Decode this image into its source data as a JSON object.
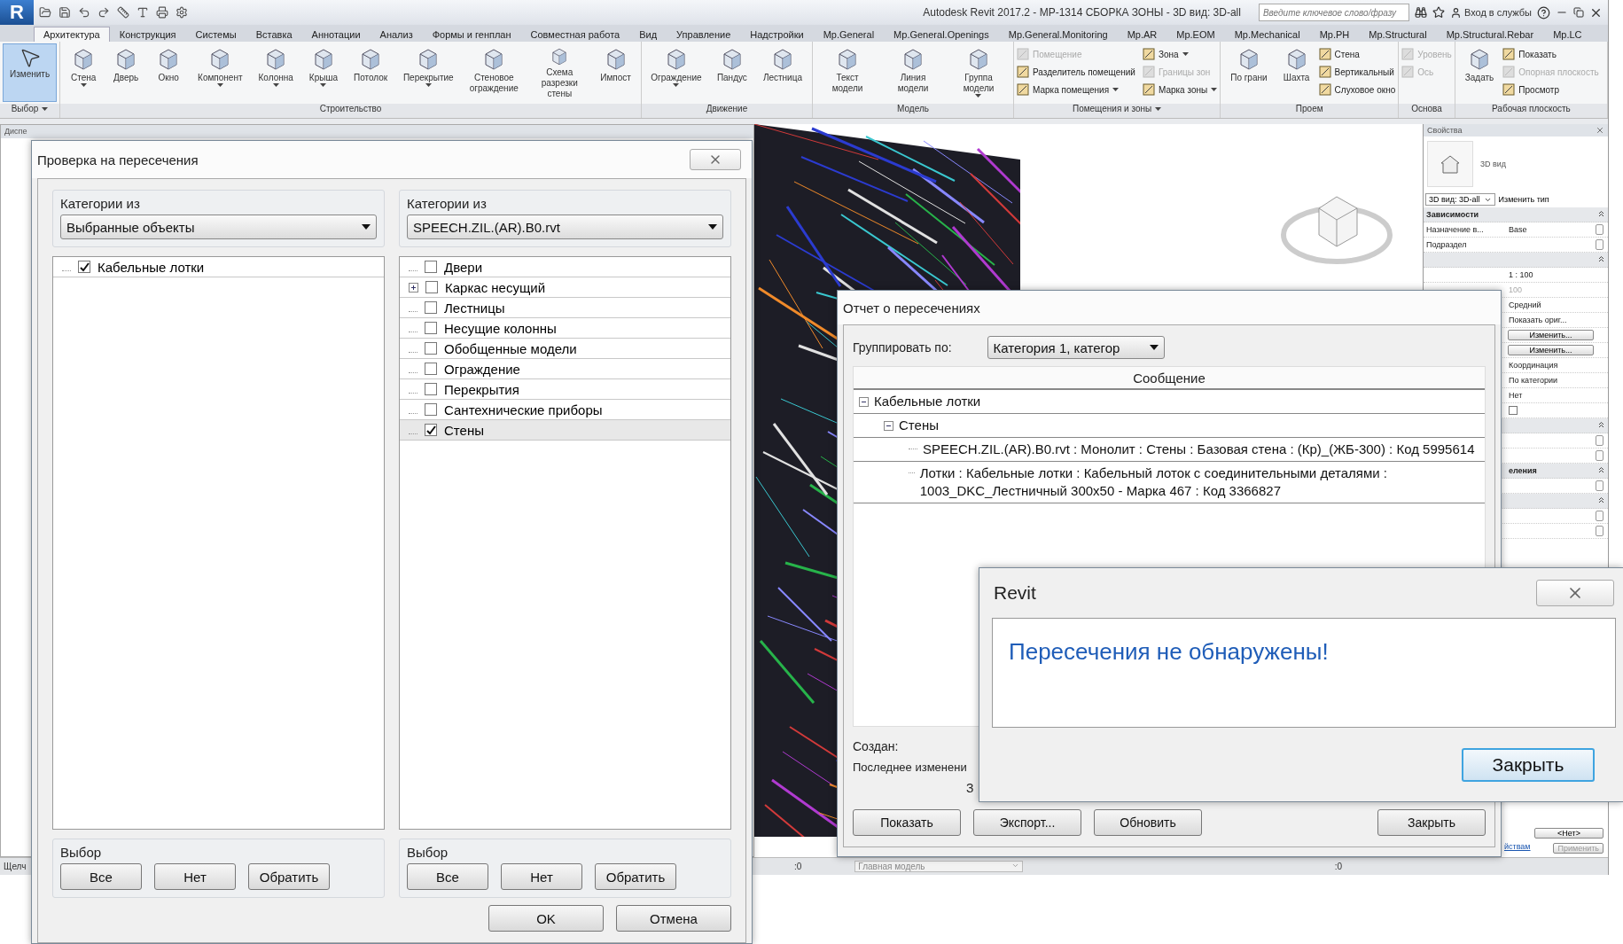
{
  "app": {
    "logo": "R",
    "title": "Autodesk Revit 2017.2 -   MP-1314 СБОРКА ЗОНЫ - 3D вид: 3D-all",
    "search_placeholder": "Введите ключевое слово/фразу",
    "sign_in": "Вход в службы",
    "tabs": [
      {
        "label": "Архитектура",
        "selected": true
      },
      {
        "label": "Конструкция",
        "selected": false
      },
      {
        "label": "Системы",
        "selected": false
      },
      {
        "label": "Вставка",
        "selected": false
      },
      {
        "label": "Аннотации",
        "selected": false
      },
      {
        "label": "Анализ",
        "selected": false
      },
      {
        "label": "Формы и генплан",
        "selected": false
      },
      {
        "label": "Совместная работа",
        "selected": false
      },
      {
        "label": "Вид",
        "selected": false
      },
      {
        "label": "Управление",
        "selected": false
      },
      {
        "label": "Надстройки",
        "selected": false
      },
      {
        "label": "Mp.General",
        "selected": false
      },
      {
        "label": "Mp.General.Openings",
        "selected": false
      },
      {
        "label": "Mp.General.Monitoring",
        "selected": false
      },
      {
        "label": "Mp.AR",
        "selected": false
      },
      {
        "label": "Mp.EOM",
        "selected": false
      },
      {
        "label": "Mp.Mechanical",
        "selected": false
      },
      {
        "label": "Mp.PH",
        "selected": false
      },
      {
        "label": "Mp.Structural",
        "selected": false
      },
      {
        "label": "Mp.Structural.Rebar",
        "selected": false
      },
      {
        "label": "Mp.LC",
        "selected": false
      }
    ],
    "panels": [
      {
        "title": "Выбор",
        "menu": true,
        "large": [
          {
            "label": "Изменить",
            "kind": "select",
            "active": true
          }
        ]
      },
      {
        "title": "Строительство",
        "menu": false,
        "large": [
          {
            "label": "Стена",
            "kind": "tool",
            "caret": true
          },
          {
            "label": "Дверь",
            "kind": "tool"
          },
          {
            "label": "Окно",
            "kind": "tool"
          },
          {
            "label": "Компонент",
            "kind": "tool",
            "caret": true
          },
          {
            "label": "Колонна",
            "kind": "tool",
            "caret": true
          },
          {
            "label": "Крыша",
            "kind": "tool",
            "caret": true
          },
          {
            "label": "Потолок",
            "kind": "tool"
          },
          {
            "label": "Перекрытие",
            "kind": "tool",
            "caret": true
          },
          {
            "label": "Стеновое ограждение",
            "kind": "tool"
          },
          {
            "label": "Схема разрезки стены",
            "kind": "tool"
          },
          {
            "label": "Импост",
            "kind": "tool"
          }
        ]
      },
      {
        "title": "Движение",
        "menu": false,
        "large": [
          {
            "label": "Ограждение",
            "kind": "tool",
            "caret": true
          },
          {
            "label": "Пандус",
            "kind": "tool"
          },
          {
            "label": "Лестница",
            "kind": "tool"
          }
        ]
      },
      {
        "title": "Модель",
        "menu": false,
        "large": [
          {
            "label": "Текст модели",
            "kind": "tool"
          },
          {
            "label": "Линия модели",
            "kind": "tool"
          },
          {
            "label": "Группа модели",
            "kind": "tool",
            "caret": true
          }
        ]
      },
      {
        "title": "Помещения и зоны",
        "menu": true,
        "small": [
          {
            "label": "Помещение",
            "disabled": true
          },
          {
            "label": "Разделитель помещений",
            "disabled": false
          },
          {
            "label": "Марка помещения",
            "disabled": false,
            "caret": true
          },
          {
            "label": "Зона",
            "disabled": false,
            "caret": true
          },
          {
            "label": "Границы зон",
            "disabled": true
          },
          {
            "label": "Марка зоны",
            "disabled": false,
            "caret": true
          }
        ]
      },
      {
        "title": "Проем",
        "menu": false,
        "large": [
          {
            "label": "По грани",
            "kind": "tool"
          },
          {
            "label": "Шахта",
            "kind": "tool"
          }
        ],
        "small": [
          {
            "label": "Стена",
            "disabled": false
          },
          {
            "label": "Вертикальный",
            "disabled": false
          },
          {
            "label": "Слуховое окно",
            "disabled": false
          }
        ]
      },
      {
        "title": "Основа",
        "menu": false,
        "small": [
          {
            "label": "Уровень",
            "disabled": true
          },
          {
            "label": "Ось",
            "disabled": true
          }
        ]
      },
      {
        "title": "Рабочая плоскость",
        "menu": false,
        "large": [
          {
            "label": "Задать",
            "kind": "tool"
          }
        ],
        "small": [
          {
            "label": "Показать",
            "disabled": false
          },
          {
            "label": "Опорная плоскость",
            "disabled": true
          },
          {
            "label": "Просмотр",
            "disabled": false
          }
        ]
      }
    ],
    "browser_title": "Диспе",
    "status_bar": {
      "hint": "Щелч",
      "workset_count": ":0",
      "model": "Главная модель",
      "filter_count": ":0"
    },
    "properties": {
      "title": "Свойства",
      "type_name": "3D вид",
      "view_selector": "3D вид: 3D-all",
      "edit_type": "Изменить тип",
      "rows": [
        {
          "kind": "group",
          "title": "Зависимости"
        },
        {
          "kind": "row",
          "name": "Назначение в...",
          "value": "Base",
          "edit": true
        },
        {
          "kind": "row",
          "name": "Подраздел",
          "edit": true
        },
        {
          "kind": "group"
        },
        {
          "kind": "row",
          "value": "1 : 100"
        },
        {
          "kind": "row",
          "value": "100",
          "disabled": true
        },
        {
          "kind": "row",
          "value": "Средний"
        },
        {
          "kind": "row",
          "value": "Показать ориг..."
        },
        {
          "kind": "button",
          "value": "Изменить..."
        },
        {
          "kind": "button",
          "value": "Изменить..."
        },
        {
          "kind": "row",
          "value": "Координация"
        },
        {
          "kind": "row",
          "value": "По категории"
        },
        {
          "kind": "row",
          "value": "Нет"
        },
        {
          "kind": "checkbox",
          "checked": false
        },
        {
          "kind": "group"
        },
        {
          "kind": "row",
          "edit": true
        },
        {
          "kind": "row",
          "edit": true
        },
        {
          "kind": "group",
          "title": "еления",
          "cut": true
        },
        {
          "kind": "row",
          "edit": true
        },
        {
          "kind": "group"
        },
        {
          "kind": "row",
          "edit": true
        },
        {
          "kind": "row",
          "edit": true
        }
      ],
      "selector_value": "<Нет>",
      "help_link": "йствам",
      "apply": "Применить"
    }
  },
  "check_dialog": {
    "title": "Проверка на пересечения",
    "columns": [
      {
        "legend": "Категории из",
        "source": "Выбранные объекты",
        "items": [
          {
            "label": "Кабельные лотки",
            "checked": true,
            "selected": false
          }
        ]
      },
      {
        "legend": "Категории из",
        "source": "SPEECH.ZIL.(AR).B0.rvt",
        "items": [
          {
            "label": "Двери",
            "checked": false,
            "selected": false
          },
          {
            "label": "Каркас несущий",
            "checked": false,
            "selected": false,
            "expanded": false
          },
          {
            "label": "Лестницы",
            "checked": false,
            "selected": false
          },
          {
            "label": "Несущие колонны",
            "checked": false,
            "selected": false
          },
          {
            "label": "Обобщенные модели",
            "checked": false,
            "selected": false
          },
          {
            "label": "Ограждение",
            "checked": false,
            "selected": false
          },
          {
            "label": "Перекрытия",
            "checked": false,
            "selected": false
          },
          {
            "label": "Сантехнические приборы",
            "checked": false,
            "selected": false
          },
          {
            "label": "Стены",
            "checked": true,
            "selected": true
          }
        ]
      }
    ],
    "selection_groups": [
      {
        "legend": "Выбор",
        "buttons": [
          "Все",
          "Нет",
          "Обратить"
        ]
      },
      {
        "legend": "Выбор",
        "buttons": [
          "Все",
          "Нет",
          "Обратить"
        ]
      }
    ],
    "buttons": [
      "OK",
      "Отмена"
    ]
  },
  "report_dialog": {
    "title": "Отчет о пересечениях",
    "group_by_label": "Группировать по:",
    "group_by": "Категория 1, категор",
    "column": "Сообщение",
    "tree": [
      {
        "label": "Кабельные лотки",
        "expanded": true,
        "children": [
          {
            "label": "Стены",
            "expanded": true,
            "children": [
              {
                "label": "SPEECH.ZIL.(AR).B0.rvt : Монолит : Стены : Базовая стена : (Кр)_(ЖБ-300) : Код 5995614"
              },
              {
                "label": "Лотки : Кабельные лотки : Кабельный лоток с соединительными деталями : 1003_DKC_Лестничный 300x50 - Марка 467 : Код 3366827"
              }
            ]
          }
        ]
      }
    ],
    "created_label": "Создан:",
    "modified_label": "Последнее изменени",
    "cut_text": "З",
    "buttons": [
      "Показать",
      "Экспорт...",
      "Обновить"
    ],
    "close": "Закрыть"
  },
  "message_box": {
    "title": "Revit",
    "message": "Пересечения не обнаружены!",
    "button": "Закрыть"
  }
}
